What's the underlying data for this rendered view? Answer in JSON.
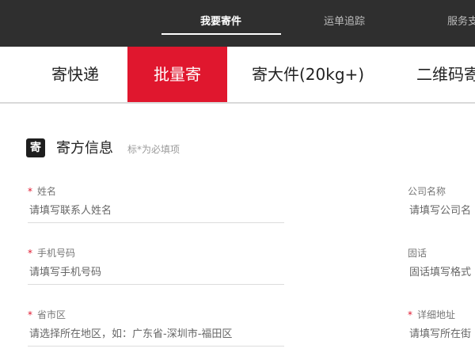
{
  "top_nav": {
    "items": [
      {
        "label": "我要寄件"
      },
      {
        "label": "运单追踪"
      },
      {
        "label": "服务支"
      }
    ]
  },
  "tabs": [
    {
      "label": "寄快递"
    },
    {
      "label": "批量寄"
    },
    {
      "label": "寄大件(20kg+)"
    },
    {
      "label": "二维码寄"
    }
  ],
  "active_tab": "批量寄",
  "section": {
    "icon_char": "寄",
    "title": "寄方信息",
    "hint": "标*为必填项"
  },
  "form": {
    "required_mark": "*",
    "left": [
      {
        "label": "姓名",
        "required": true,
        "placeholder": "请填写联系人姓名"
      },
      {
        "label": "手机号码",
        "required": true,
        "placeholder": "请填写手机号码"
      },
      {
        "label": "省市区",
        "required": true,
        "placeholder": "请选择所在地区，如：广东省-深圳市-福田区"
      }
    ],
    "right": [
      {
        "label": "公司名称",
        "required": false,
        "placeholder": "请填写公司名"
      },
      {
        "label": "固话",
        "required": false,
        "placeholder": "固话填写格式"
      },
      {
        "label": "详细地址",
        "required": true,
        "placeholder": "请填写所在街"
      }
    ]
  },
  "colors": {
    "nav_bg": "#2f2f2f",
    "accent": "#e0172e"
  }
}
